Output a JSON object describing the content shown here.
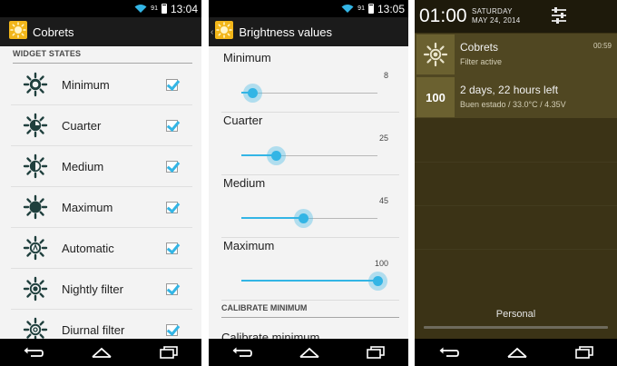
{
  "status_bar_1": {
    "battery": "91",
    "time": "13:04"
  },
  "status_bar_2": {
    "battery": "91",
    "time": "13:05"
  },
  "phone1": {
    "title": "Cobrets",
    "section": "WIDGET STATES",
    "items": [
      {
        "label": "Minimum",
        "icon": "sun-minimum-icon",
        "checked": true
      },
      {
        "label": "Cuarter",
        "icon": "sun-quarter-icon",
        "checked": true
      },
      {
        "label": "Medium",
        "icon": "sun-medium-icon",
        "checked": true
      },
      {
        "label": "Maximum",
        "icon": "sun-maximum-icon",
        "checked": true
      },
      {
        "label": "Automatic",
        "icon": "sun-automatic-icon",
        "checked": true
      },
      {
        "label": "Nightly filter",
        "icon": "sun-nightly-icon",
        "checked": true
      },
      {
        "label": "Diurnal filter",
        "icon": "sun-diurnal-icon",
        "checked": true
      }
    ]
  },
  "phone2": {
    "title": "Brightness values",
    "sliders": [
      {
        "label": "Minimum",
        "value": "8",
        "percent": 8
      },
      {
        "label": "Cuarter",
        "value": "25",
        "percent": 25
      },
      {
        "label": "Medium",
        "value": "45",
        "percent": 45
      },
      {
        "label": "Maximum",
        "value": "100",
        "percent": 100
      }
    ],
    "calibrate_section": "CALIBRATE MINIMUM",
    "calibrate_item": "Calibrate minimum"
  },
  "phone3": {
    "time": "01:00",
    "day": "SATURDAY",
    "date": "MAY 24, 2014",
    "notifications": [
      {
        "title": "Cobrets",
        "subtitle": "Filter active",
        "time": "00:59",
        "icon": "sun-icon"
      },
      {
        "badge": "100",
        "title": "2 days, 22 hours left",
        "subtitle": "Buen estado / 33.0°C / 4.35V"
      }
    ],
    "user": "Personal"
  },
  "colors": {
    "accent": "#33b5e5",
    "action_bar": "#1b1b1b",
    "shade_bg": "#3b3316",
    "notification_bg": "#504722"
  }
}
